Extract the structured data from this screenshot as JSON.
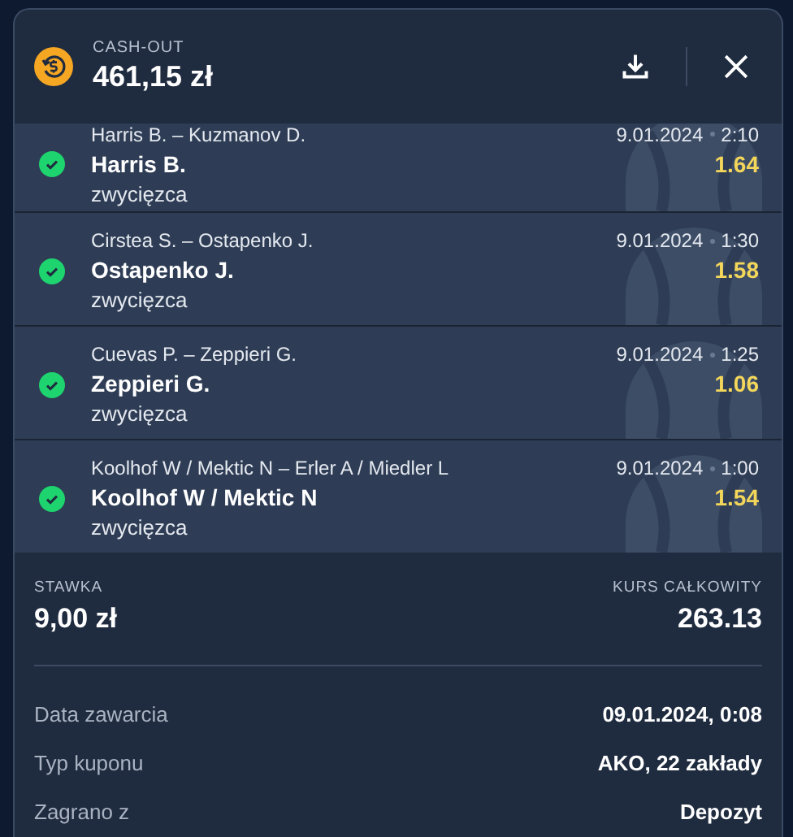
{
  "header": {
    "label": "CASH-OUT",
    "amount": "461,15 zł"
  },
  "bets": [
    {
      "match": "Harris B. – Kuzmanov D.",
      "date": "9.01.2024",
      "time": "2:10",
      "selection": "Harris B.",
      "market": "zwycięzca",
      "odds": "1.64",
      "won": true
    },
    {
      "match": "Cirstea S. – Ostapenko J.",
      "date": "9.01.2024",
      "time": "1:30",
      "selection": "Ostapenko J.",
      "market": "zwycięzca",
      "odds": "1.58",
      "won": true
    },
    {
      "match": "Cuevas P. – Zeppieri G.",
      "date": "9.01.2024",
      "time": "1:25",
      "selection": "Zeppieri G.",
      "market": "zwycięzca",
      "odds": "1.06",
      "won": true
    },
    {
      "match": "Koolhof W / Mektic N – Erler A / Miedler L",
      "date": "9.01.2024",
      "time": "1:00",
      "selection": "Koolhof W / Mektic N",
      "market": "zwycięzca",
      "odds": "1.54",
      "won": true
    }
  ],
  "summary": {
    "stake_label": "STAWKA",
    "stake": "9,00 zł",
    "odds_label": "KURS CAŁKOWITY",
    "odds": "263.13"
  },
  "details": [
    {
      "label": "Data zawarcia",
      "value": "09.01.2024, 0:08"
    },
    {
      "label": "Typ kuponu",
      "value": "AKO, 22 zakłady"
    },
    {
      "label": "Zagrano z",
      "value": "Depozyt"
    }
  ]
}
